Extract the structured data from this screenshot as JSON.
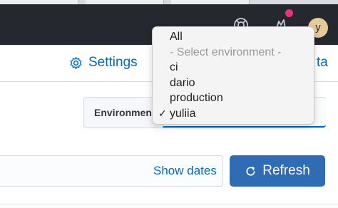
{
  "header": {
    "avatar_initial": "y",
    "icons": [
      "help-icon",
      "newsfeed-icon"
    ]
  },
  "subnav": {
    "settings_label": "Settings",
    "data_link_label": "ta"
  },
  "environment": {
    "label": "Environment",
    "selected": "yuliia"
  },
  "dropdown": {
    "options": [
      {
        "label": "All",
        "disabled": false,
        "checked": false
      },
      {
        "label": "- Select environment -",
        "disabled": true,
        "checked": false
      },
      {
        "label": "ci",
        "disabled": false,
        "checked": false
      },
      {
        "label": "dario",
        "disabled": false,
        "checked": false
      },
      {
        "label": "production",
        "disabled": false,
        "checked": false
      },
      {
        "label": "yuliia",
        "disabled": false,
        "checked": true
      }
    ],
    "check_glyph": "✓"
  },
  "toolbar": {
    "show_dates_label": "Show dates",
    "refresh_label": "Refresh"
  },
  "colors": {
    "header_bg": "#25282f",
    "link": "#006bb8",
    "primary_button": "#2f6cb3",
    "notification": "#e8347b"
  }
}
